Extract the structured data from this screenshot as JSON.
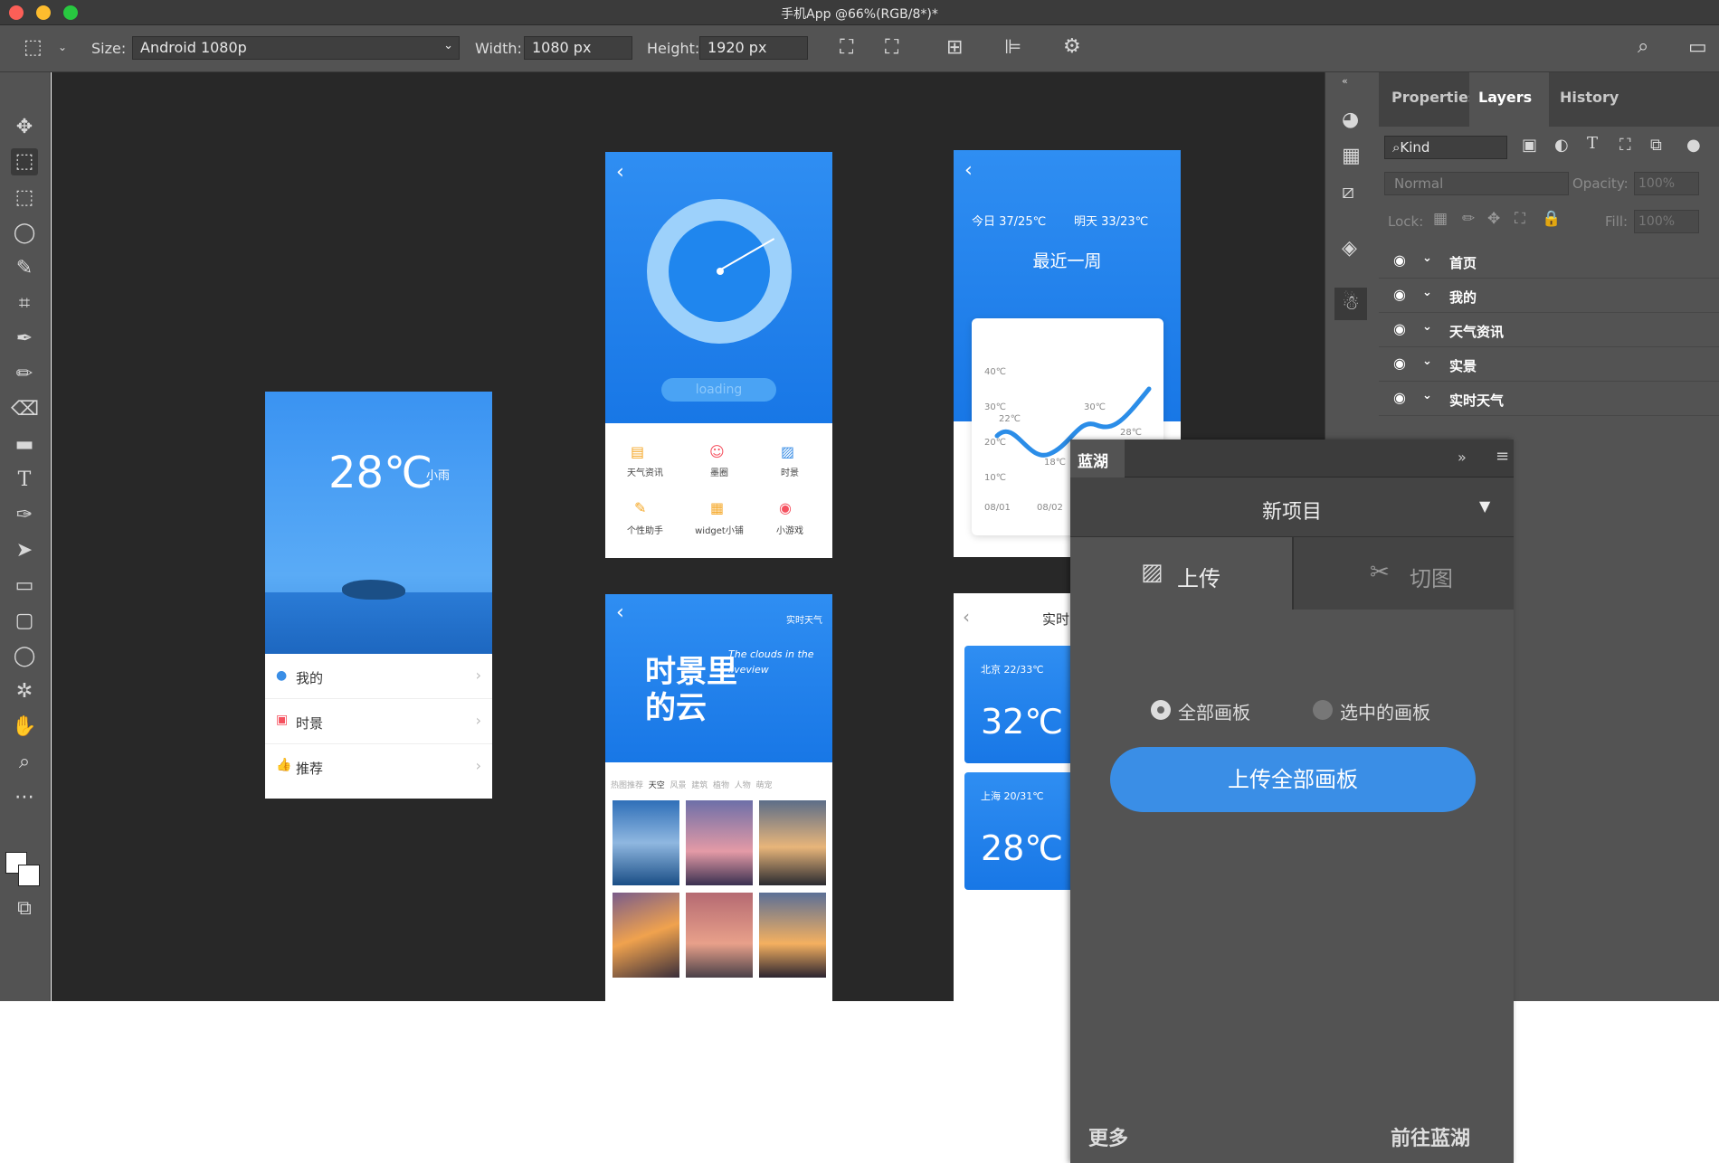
{
  "window": {
    "title": "手机App @66%(RGB/8*)*"
  },
  "options_bar": {
    "size_label": "Size:",
    "size_value": "Android 1080p",
    "width_label": "Width:",
    "width_value": "1080 px",
    "height_label": "Height:",
    "height_value": "1920 px"
  },
  "panel": {
    "tabs": [
      "Properties",
      "Layers",
      "History"
    ],
    "active_tab": "Layers",
    "kind_label": "Kind",
    "blend_mode": "Normal",
    "opacity_label": "Opacity:",
    "opacity_value": "100%",
    "lock_label": "Lock:",
    "fill_label": "Fill:",
    "fill_value": "100%",
    "layers": [
      "首页",
      "我的",
      "天气资讯",
      "实景",
      "实时天气"
    ]
  },
  "artboards": {
    "home": {
      "temp": "28℃",
      "condition": "小雨",
      "menu": [
        "我的",
        "时景",
        "推荐"
      ]
    },
    "loading": {
      "loading_text": "loading",
      "grid": [
        "天气资讯",
        "墨圈",
        "时景",
        "个性助手",
        "widget小铺",
        "小游戏"
      ]
    },
    "week": {
      "today": "今日  37/25℃",
      "tomorrow": "明天  33/23℃",
      "heading": "最近一周",
      "y_labels": [
        "40℃",
        "30℃",
        "20℃",
        "10℃"
      ],
      "point_labels": [
        "22℃",
        "18℃",
        "30℃",
        "28℃"
      ],
      "x_labels": [
        "08/01",
        "08/02"
      ]
    },
    "clouds": {
      "top_right": "实时天气",
      "headline": "时景里的云",
      "script": "The clouds in the liveview",
      "tabs": [
        "热图推荐",
        "天空",
        "风景",
        "建筑",
        "植物",
        "人物",
        "萌宠"
      ]
    },
    "realtime": {
      "title": "实时",
      "cards": [
        {
          "city": "北京 22/33℃",
          "temp": "32℃"
        },
        {
          "city": "上海 20/31℃",
          "temp": "28℃"
        }
      ]
    }
  },
  "lanhu": {
    "title": "蓝湖",
    "project": "新项目",
    "tabs": [
      "上传",
      "切图"
    ],
    "radio_all": "全部画板",
    "radio_selected": "选中的画板",
    "upload_button": "上传全部画板",
    "more": "更多",
    "goto": "前往蓝湖"
  },
  "colors": {
    "accent": "#3a8ee6",
    "sky": "#1877e6",
    "ps_bg": "#535353",
    "canvas": "#282828"
  }
}
